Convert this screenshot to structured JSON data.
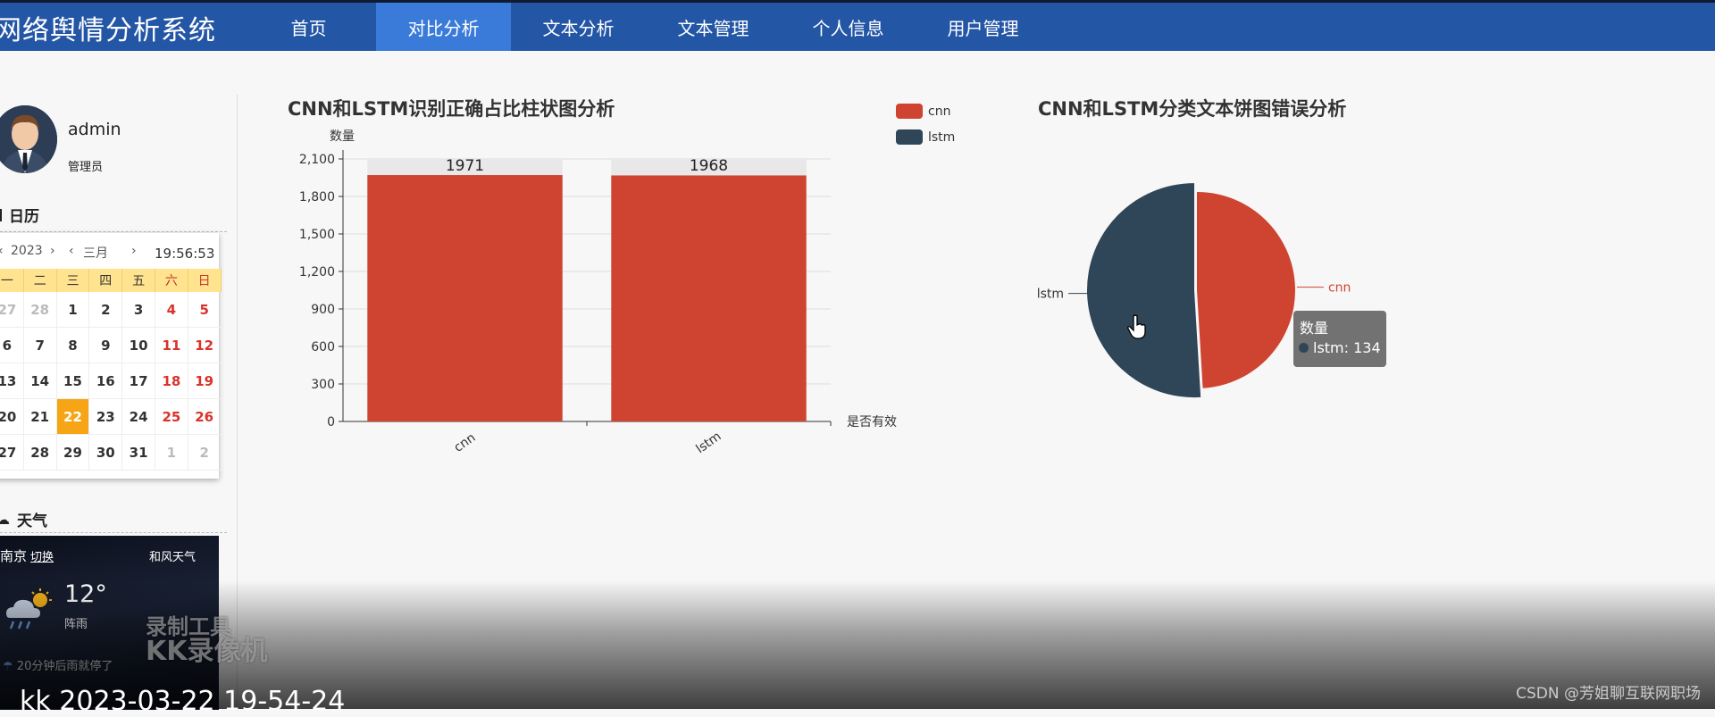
{
  "app": {
    "title": "网络舆情分析系统"
  },
  "nav": [
    {
      "label": "首页",
      "active": false
    },
    {
      "label": "对比分析",
      "active": true
    },
    {
      "label": "文本分析",
      "active": false
    },
    {
      "label": "文本管理",
      "active": false
    },
    {
      "label": "个人信息",
      "active": false
    },
    {
      "label": "用户管理",
      "active": false
    }
  ],
  "sidebar": {
    "user": {
      "name": "admin",
      "role": "管理员"
    },
    "calendar": {
      "section_title": "日历",
      "year": "2023",
      "month": "三月",
      "time": "19:56:53",
      "weekdays": [
        "一",
        "二",
        "三",
        "四",
        "五",
        "六",
        "日"
      ],
      "weeks": [
        [
          "27",
          "28",
          "1",
          "2",
          "3",
          "4",
          "5"
        ],
        [
          "6",
          "7",
          "8",
          "9",
          "10",
          "11",
          "12"
        ],
        [
          "13",
          "14",
          "15",
          "16",
          "17",
          "18",
          "19"
        ],
        [
          "20",
          "21",
          "22",
          "23",
          "24",
          "25",
          "26"
        ],
        [
          "27",
          "28",
          "29",
          "30",
          "31",
          "1",
          "2"
        ]
      ],
      "today": "22"
    },
    "weather": {
      "section_title": "天气",
      "city": "南京",
      "switch_label": "切换",
      "brand": "和风天气",
      "temperature": "12°",
      "condition": "阵雨",
      "tip": "20分钟后雨就停了"
    }
  },
  "bar_panel": {
    "title": "CNN和LSTM识别正确占比柱状图分析"
  },
  "pie_panel": {
    "title": "CNN和LSTM分类文本饼图错误分析"
  },
  "legend": [
    {
      "name": "cnn",
      "color": "#cf4431"
    },
    {
      "name": "lstm",
      "color": "#2f4558"
    }
  ],
  "chart_data": [
    {
      "type": "bar",
      "title": "CNN和LSTM识别正确占比柱状图分析",
      "ylabel": "数量",
      "xlabel": "是否有效",
      "categories": [
        "cnn",
        "lstm"
      ],
      "values": [
        1971,
        1968
      ],
      "ylim": [
        0,
        2100
      ],
      "yticks": [
        "0",
        "300",
        "600",
        "900",
        "1,200",
        "1,500",
        "1,800",
        "2,100"
      ],
      "grid": true,
      "color": "#cf4431"
    },
    {
      "type": "pie",
      "title": "CNN和LSTM分类文本饼图错误分析",
      "labels": [
        "cnn",
        "lstm"
      ],
      "values": [
        129,
        134
      ],
      "colors": [
        "#cf4431",
        "#2f4558"
      ],
      "highlighted": "lstm"
    }
  ],
  "tooltip": {
    "series": "数量",
    "label": "lstm: 134"
  },
  "overlay": {
    "watermark_line1": "录制工具",
    "watermark_line2": "KK录像机",
    "timestamp": "kk 2023-03-22 19-54-24",
    "credit": "CSDN @芳姐聊互联网职场"
  }
}
